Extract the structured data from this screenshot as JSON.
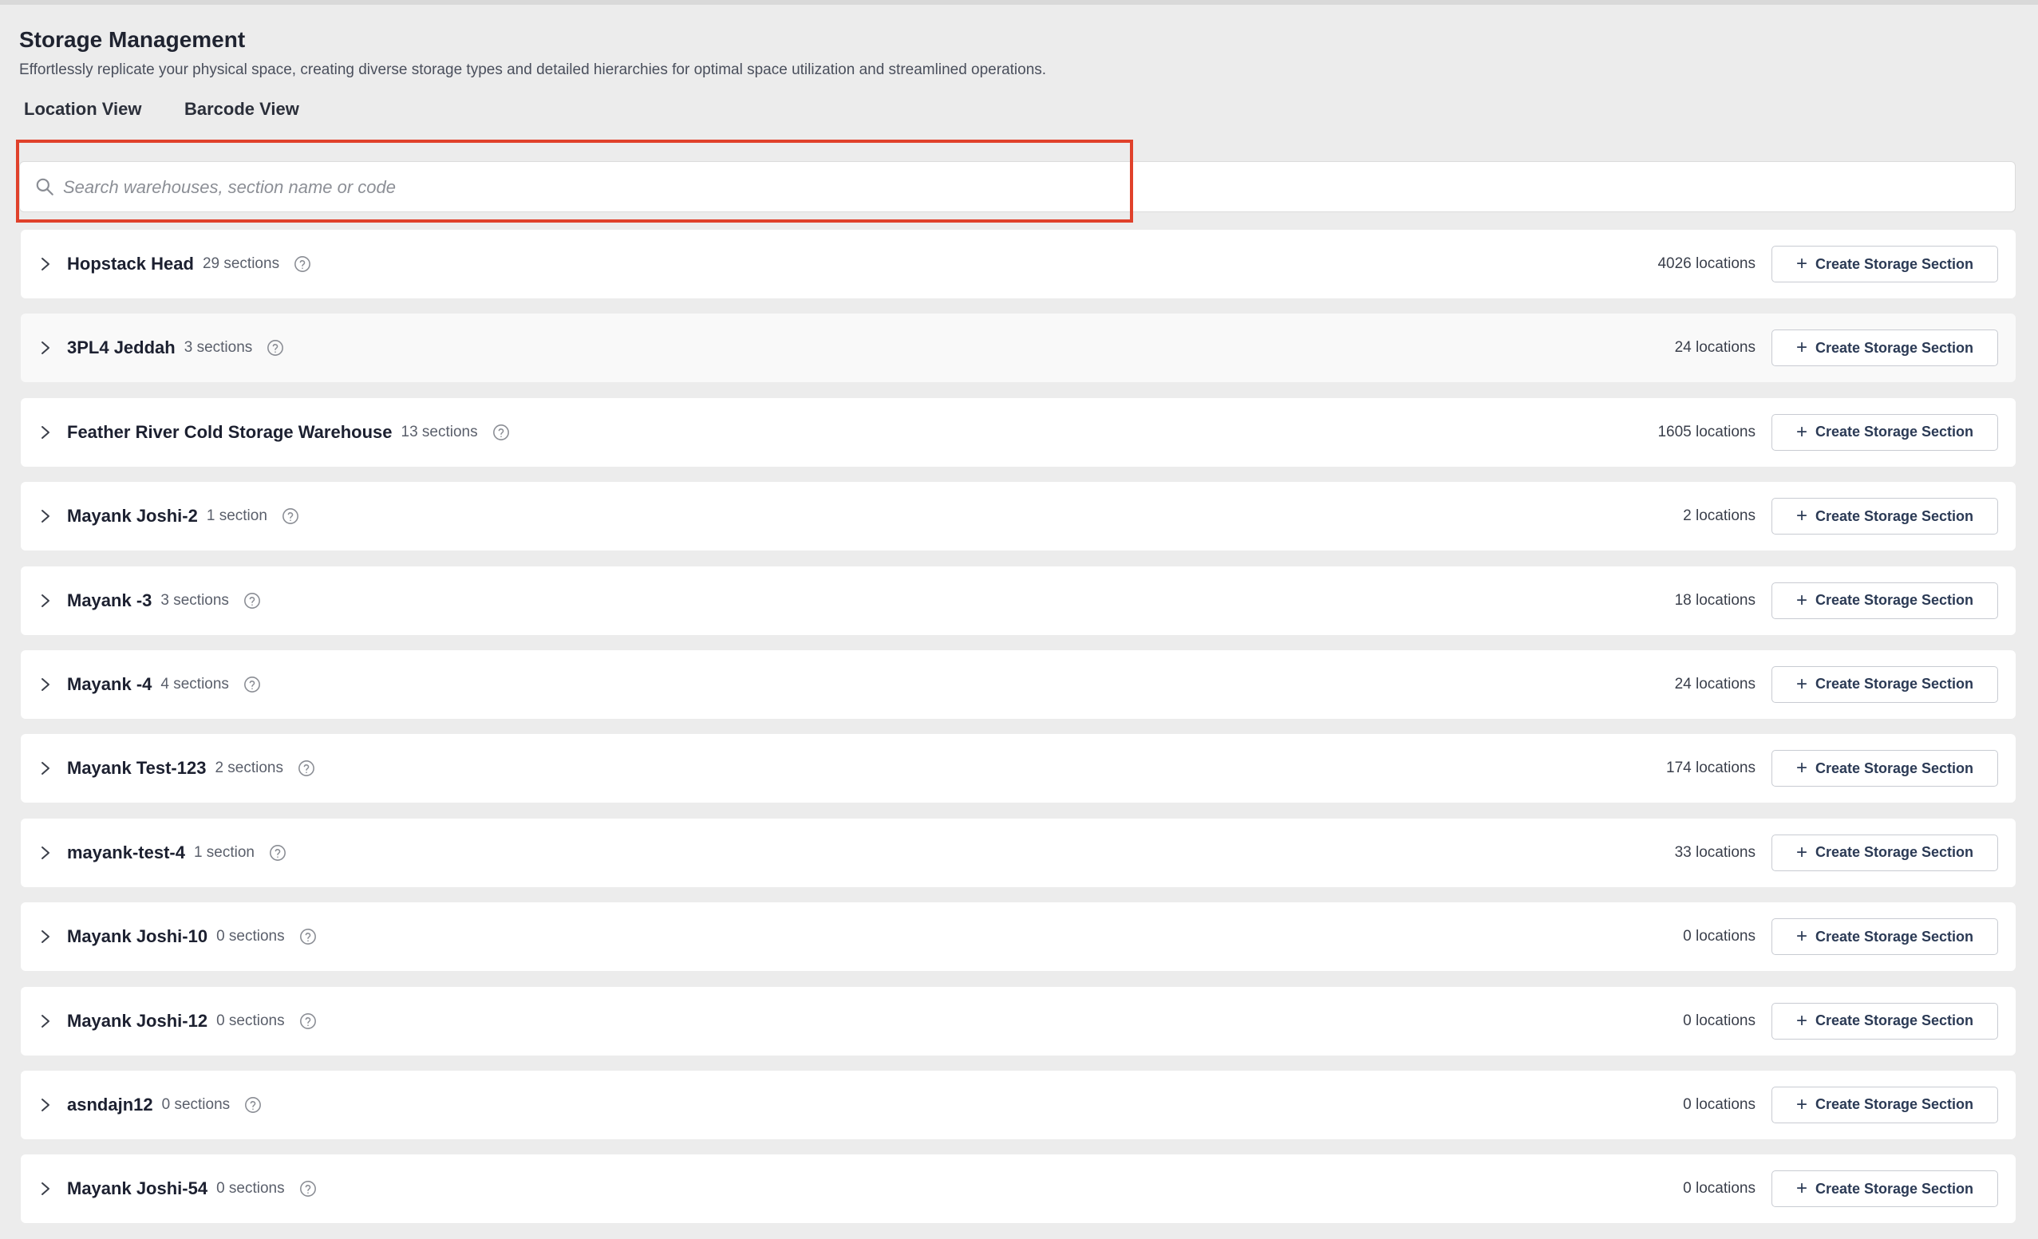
{
  "header": {
    "title": "Storage Management",
    "subtitle": "Effortlessly replicate your physical space, creating diverse storage types and detailed hierarchies for optimal space utilization and streamlined operations."
  },
  "tabs": [
    {
      "label": "Location View",
      "active": true
    },
    {
      "label": "Barcode View",
      "active": false
    }
  ],
  "search": {
    "placeholder": "Search warehouses, section name or code",
    "value": ""
  },
  "colors": {
    "highlight": "#e0412b",
    "background": "#ececec",
    "button_text": "#2b3a55"
  },
  "icons": {
    "search": "search-icon",
    "expand": "chevron-right-icon",
    "help": "help-circle-icon",
    "create": "plus-icon"
  },
  "warehouses": [
    {
      "name": "Hopstack Head",
      "sections": "29 sections",
      "locations": "4026 locations",
      "button": "Create Storage Section"
    },
    {
      "name": "3PL4 Jeddah",
      "sections": "3 sections",
      "locations": "24 locations",
      "button": "Create Storage Section"
    },
    {
      "name": "Feather River Cold Storage Warehouse",
      "sections": "13 sections",
      "locations": "1605 locations",
      "button": "Create Storage Section"
    },
    {
      "name": "Mayank Joshi-2",
      "sections": "1 section",
      "locations": "2 locations",
      "button": "Create Storage Section"
    },
    {
      "name": "Mayank -3",
      "sections": "3 sections",
      "locations": "18 locations",
      "button": "Create Storage Section"
    },
    {
      "name": "Mayank -4",
      "sections": "4 sections",
      "locations": "24 locations",
      "button": "Create Storage Section"
    },
    {
      "name": "Mayank Test-123",
      "sections": "2 sections",
      "locations": "174 locations",
      "button": "Create Storage Section"
    },
    {
      "name": "mayank-test-4",
      "sections": "1 section",
      "locations": "33 locations",
      "button": "Create Storage Section"
    },
    {
      "name": "Mayank Joshi-10",
      "sections": "0 sections",
      "locations": "0 locations",
      "button": "Create Storage Section"
    },
    {
      "name": "Mayank Joshi-12",
      "sections": "0 sections",
      "locations": "0 locations",
      "button": "Create Storage Section"
    },
    {
      "name": "asndajn12",
      "sections": "0 sections",
      "locations": "0 locations",
      "button": "Create Storage Section"
    },
    {
      "name": "Mayank Joshi-54",
      "sections": "0 sections",
      "locations": "0 locations",
      "button": "Create Storage Section"
    }
  ]
}
